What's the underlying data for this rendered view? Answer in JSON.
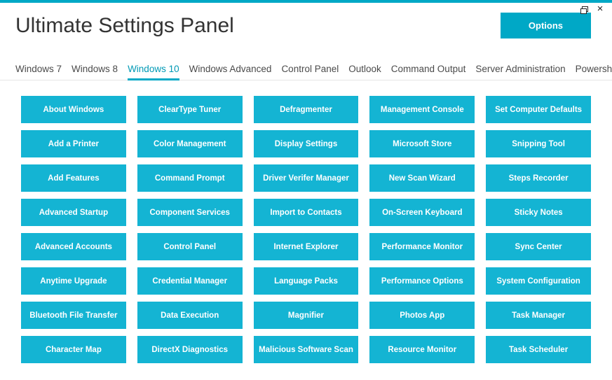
{
  "window": {
    "title": "Ultimate Settings Panel",
    "options_label": "Options"
  },
  "tabs": [
    {
      "label": "Windows 7",
      "active": false
    },
    {
      "label": "Windows 8",
      "active": false
    },
    {
      "label": "Windows 10",
      "active": true
    },
    {
      "label": "Windows Advanced",
      "active": false
    },
    {
      "label": "Control Panel",
      "active": false
    },
    {
      "label": "Outlook",
      "active": false
    },
    {
      "label": "Command Output",
      "active": false
    },
    {
      "label": "Server Administration",
      "active": false
    },
    {
      "label": "Powershell",
      "active": false
    }
  ],
  "grid": {
    "rows": 8,
    "cols": 5,
    "tiles": [
      "About Windows",
      "Add a Printer",
      "Add Features",
      "Advanced Startup",
      "Advanced Accounts",
      "Anytime Upgrade",
      "Bluetooth File Transfer",
      "Character Map",
      "ClearType Tuner",
      "Color Management",
      "Command Prompt",
      "Component Services",
      "Control Panel",
      "Credential Manager",
      "Data Execution",
      "DirectX Diagnostics",
      "Defragmenter",
      "Display Settings",
      "Driver Verifer Manager",
      "Import to Contacts",
      "Internet Explorer",
      "Language Packs",
      "Magnifier",
      "Malicious Software Scan",
      "Management Console",
      "Microsoft Store",
      "New Scan Wizard",
      "On-Screen Keyboard",
      "Performance Monitor",
      "Performance Options",
      "Photos App",
      "Resource Monitor",
      "Set Computer Defaults",
      "Snipping Tool",
      "Steps Recorder",
      "Sticky Notes",
      "Sync Center",
      "System Configuration",
      "Task Manager",
      "Task Scheduler"
    ]
  },
  "accent": "#00a8c6",
  "tile_color": "#14b4d3"
}
